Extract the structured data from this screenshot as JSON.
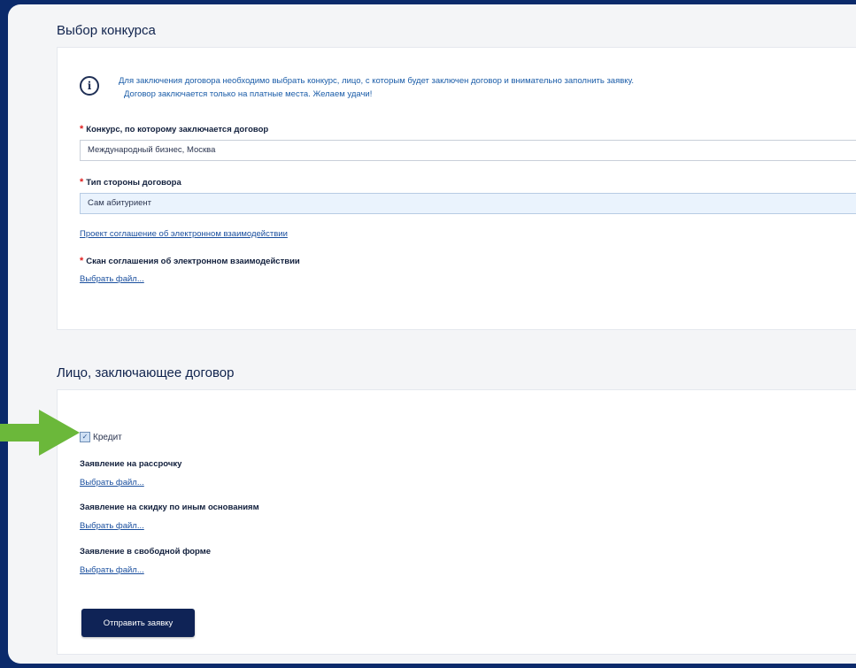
{
  "section_contest": {
    "title": "Выбор конкурса",
    "info_line1": "Для заключения договора необходимо выбрать конкурс, лицо, с которым будет заключен договор и внимательно заполнить заявку.",
    "info_line2": "Договор заключается только на платные места. Желаем удачи!",
    "contest_label": "Конкурс, по которому заключается договор",
    "contest_value": "Международный бизнес, Москва",
    "party_label": "Тип стороны договора",
    "party_value": "Сам абитуриент",
    "project_link": "Проект соглашение об электронном взаимодействии",
    "scan_label": "Скан соглашения об электронном взаимодействии",
    "scan_file_link": "Выбрать файл..."
  },
  "section_person": {
    "title": "Лицо, заключающее договор",
    "credit_label": "Кредит",
    "credit_checked": true,
    "installment_label": "Заявление на рассрочку",
    "installment_file_link": "Выбрать файл...",
    "discount_label": "Заявление на скидку по иным основаниям",
    "discount_file_link": "Выбрать файл...",
    "free_form_label": "Заявление в свободной форме",
    "free_form_file_link": "Выбрать файл...",
    "submit_label": "Отправить заявку"
  },
  "required_mark": "*",
  "colors": {
    "background": "#0b2a6b",
    "accent_button": "#0f2356",
    "link": "#1a4f9e",
    "required": "#e02020",
    "annotation_arrow": "#6bb83a"
  }
}
